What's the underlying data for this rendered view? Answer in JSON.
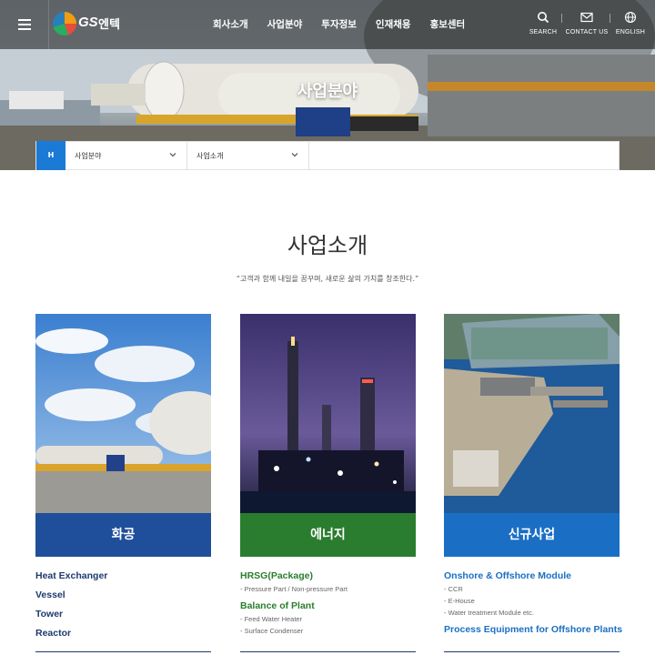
{
  "header": {
    "logo_text": "GS",
    "logo_sub": "엔텍",
    "nav": [
      "회사소개",
      "사업분야",
      "투자정보",
      "인재채용",
      "홍보센터"
    ],
    "utilities": [
      {
        "label": "SEARCH",
        "icon": "search-icon"
      },
      {
        "label": "CONTACT US",
        "icon": "mail-icon"
      },
      {
        "label": "ENGLISH",
        "icon": "globe-icon"
      }
    ]
  },
  "hero": {
    "title": "사업분야"
  },
  "breadcrumb": {
    "home_label": "H",
    "level1": "사업분야",
    "level2": "사업소개"
  },
  "section": {
    "title": "사업소개",
    "quote": "“고객과 함께 내일을 꿈꾸며, 새로운 삶의 가치를 창조한다.”"
  },
  "cards": [
    {
      "name": "화공",
      "color": "#1f4e9a",
      "items": [
        {
          "type": "main",
          "text": "Heat Exchanger"
        },
        {
          "type": "main",
          "text": "Vessel"
        },
        {
          "type": "main",
          "text": "Tower"
        },
        {
          "type": "main",
          "text": "Reactor"
        }
      ]
    },
    {
      "name": "에너지",
      "color": "#2a7d2e",
      "items": [
        {
          "type": "main",
          "text": "HRSG(Package)"
        },
        {
          "type": "sub",
          "text": "- Pressure Part / Non-pressure Part"
        },
        {
          "type": "main",
          "text": "Balance of Plant"
        },
        {
          "type": "sub",
          "text": "- Feed Water Heater"
        },
        {
          "type": "sub",
          "text": "- Surface Condenser"
        }
      ]
    },
    {
      "name": "신규사업",
      "color": "#1a6fc4",
      "items": [
        {
          "type": "main",
          "text": "Onshore & Offshore Module"
        },
        {
          "type": "sub",
          "text": "- CCR"
        },
        {
          "type": "sub",
          "text": "- E-House"
        },
        {
          "type": "sub",
          "text": "- Water treatment Module etc."
        },
        {
          "type": "main",
          "text": "Process Equipment  for Offshore Plants"
        }
      ]
    }
  ],
  "colors": {
    "accent_blue": "#1a7ad6",
    "chem_text": "#1d3a6e",
    "energy_text": "#2a7d2e",
    "new_text": "#1a6fc4"
  }
}
